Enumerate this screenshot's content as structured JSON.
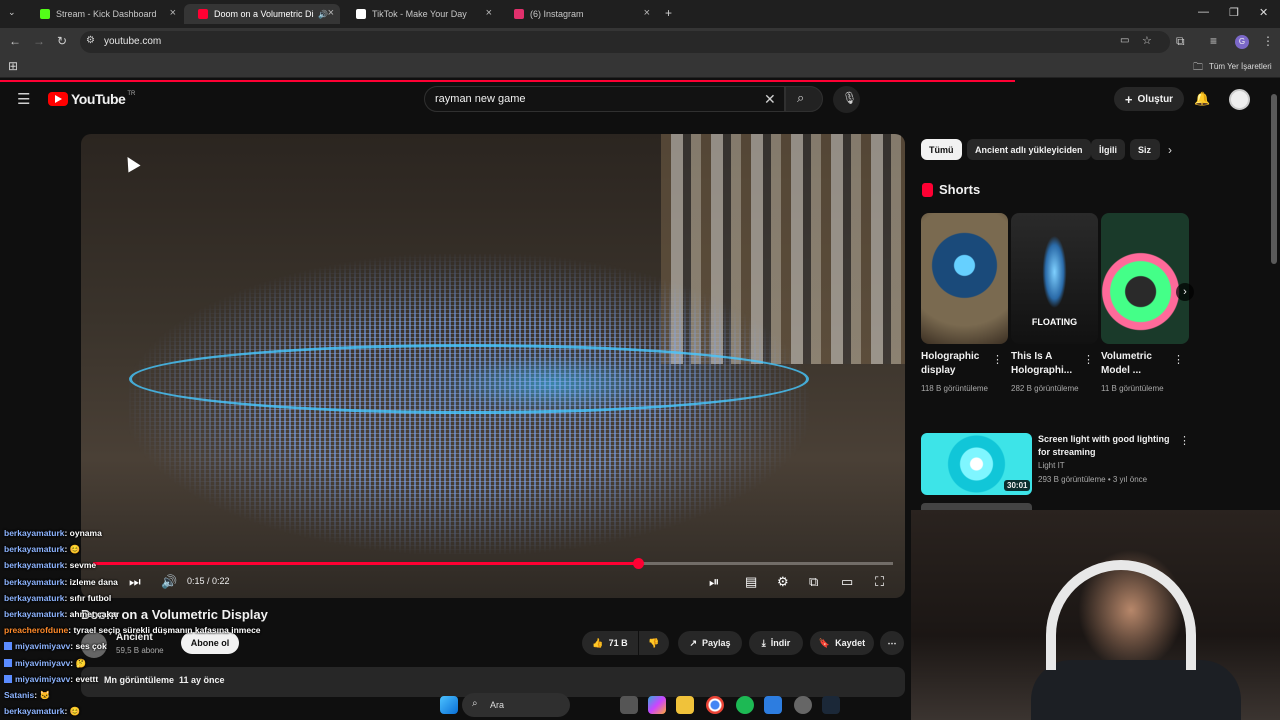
{
  "browser": {
    "tabs": [
      {
        "label": "Stream - Kick Dashboard",
        "color": "#53fc18"
      },
      {
        "label": "Doom on a Volumetric Display",
        "color": "#ff0033"
      },
      {
        "label": "TikTok - Make Your Day",
        "color": "#ffffff"
      },
      {
        "label": "(6) Instagram",
        "color": "#e1306c"
      }
    ],
    "url": "youtube.com",
    "bookmarks_label": "Tüm Yer İşaretleri"
  },
  "youtube": {
    "logo_text": "YouTube",
    "region": "TR",
    "search_value": "rayman new game",
    "create_label": "Oluştur",
    "accent": "#ff0033"
  },
  "video": {
    "title": "Doom on a Volumetric Display",
    "time": "0:15 / 0:22",
    "progress": 0.6818,
    "channel": "Ancient",
    "subscribers": "59,5 B abone",
    "subscribe_label": "Abone ol",
    "likes": "71 B",
    "share_label": "Paylaş",
    "download_label": "İndir",
    "save_label": "Kaydet",
    "views": "Mn görüntüleme",
    "age": "11 ay önce"
  },
  "chips": [
    "Tümü",
    "Ancient adlı yükleyiciden",
    "İlgili",
    "Siz"
  ],
  "shorts": {
    "title": "Shorts",
    "items": [
      {
        "title": "Holographic display",
        "views": "118 B görüntüleme"
      },
      {
        "title": "This Is A Holographi...",
        "views": "282 B görüntüleme",
        "overlay": "FLOATING"
      },
      {
        "title": "Volumetric Model ...",
        "views": "11 B görüntüleme"
      }
    ]
  },
  "recommended": [
    {
      "title": "Screen light with good lighting for streaming",
      "channel": "Light IT",
      "views": "293 B görüntüleme",
      "age": "3 yıl önce",
      "duration": "30:01"
    }
  ],
  "chat": [
    {
      "user": "berkayamaturk",
      "msg": ": oynama"
    },
    {
      "user": "berkayamaturk",
      "msg": ": 😊"
    },
    {
      "user": "berkayamaturk",
      "msg": ": sevme"
    },
    {
      "user": "berkayamaturk",
      "msg": ": izleme dana"
    },
    {
      "user": "berkayamaturk",
      "msg": ": sıfır futbol"
    },
    {
      "user": "berkayamaturk",
      "msg": ": ahmet çakar"
    },
    {
      "user": "preacherofdune",
      "msg": ": tyrael seçip sürekli düşmanın kafasına inmece",
      "orange": true
    },
    {
      "user": "miyavimiyavv",
      "msg": ": ses çok",
      "badge": true
    },
    {
      "user": "miyavimiyavv",
      "msg": ": 🤔",
      "badge": true
    },
    {
      "user": "miyavimiyavv",
      "msg": ": evettt",
      "badge": true
    },
    {
      "user": "Satanis",
      "msg": ": 🐱"
    },
    {
      "user": "berkayamaturk",
      "msg": ": 😊"
    }
  ],
  "taskbar": {
    "search_placeholder": "Ara"
  }
}
